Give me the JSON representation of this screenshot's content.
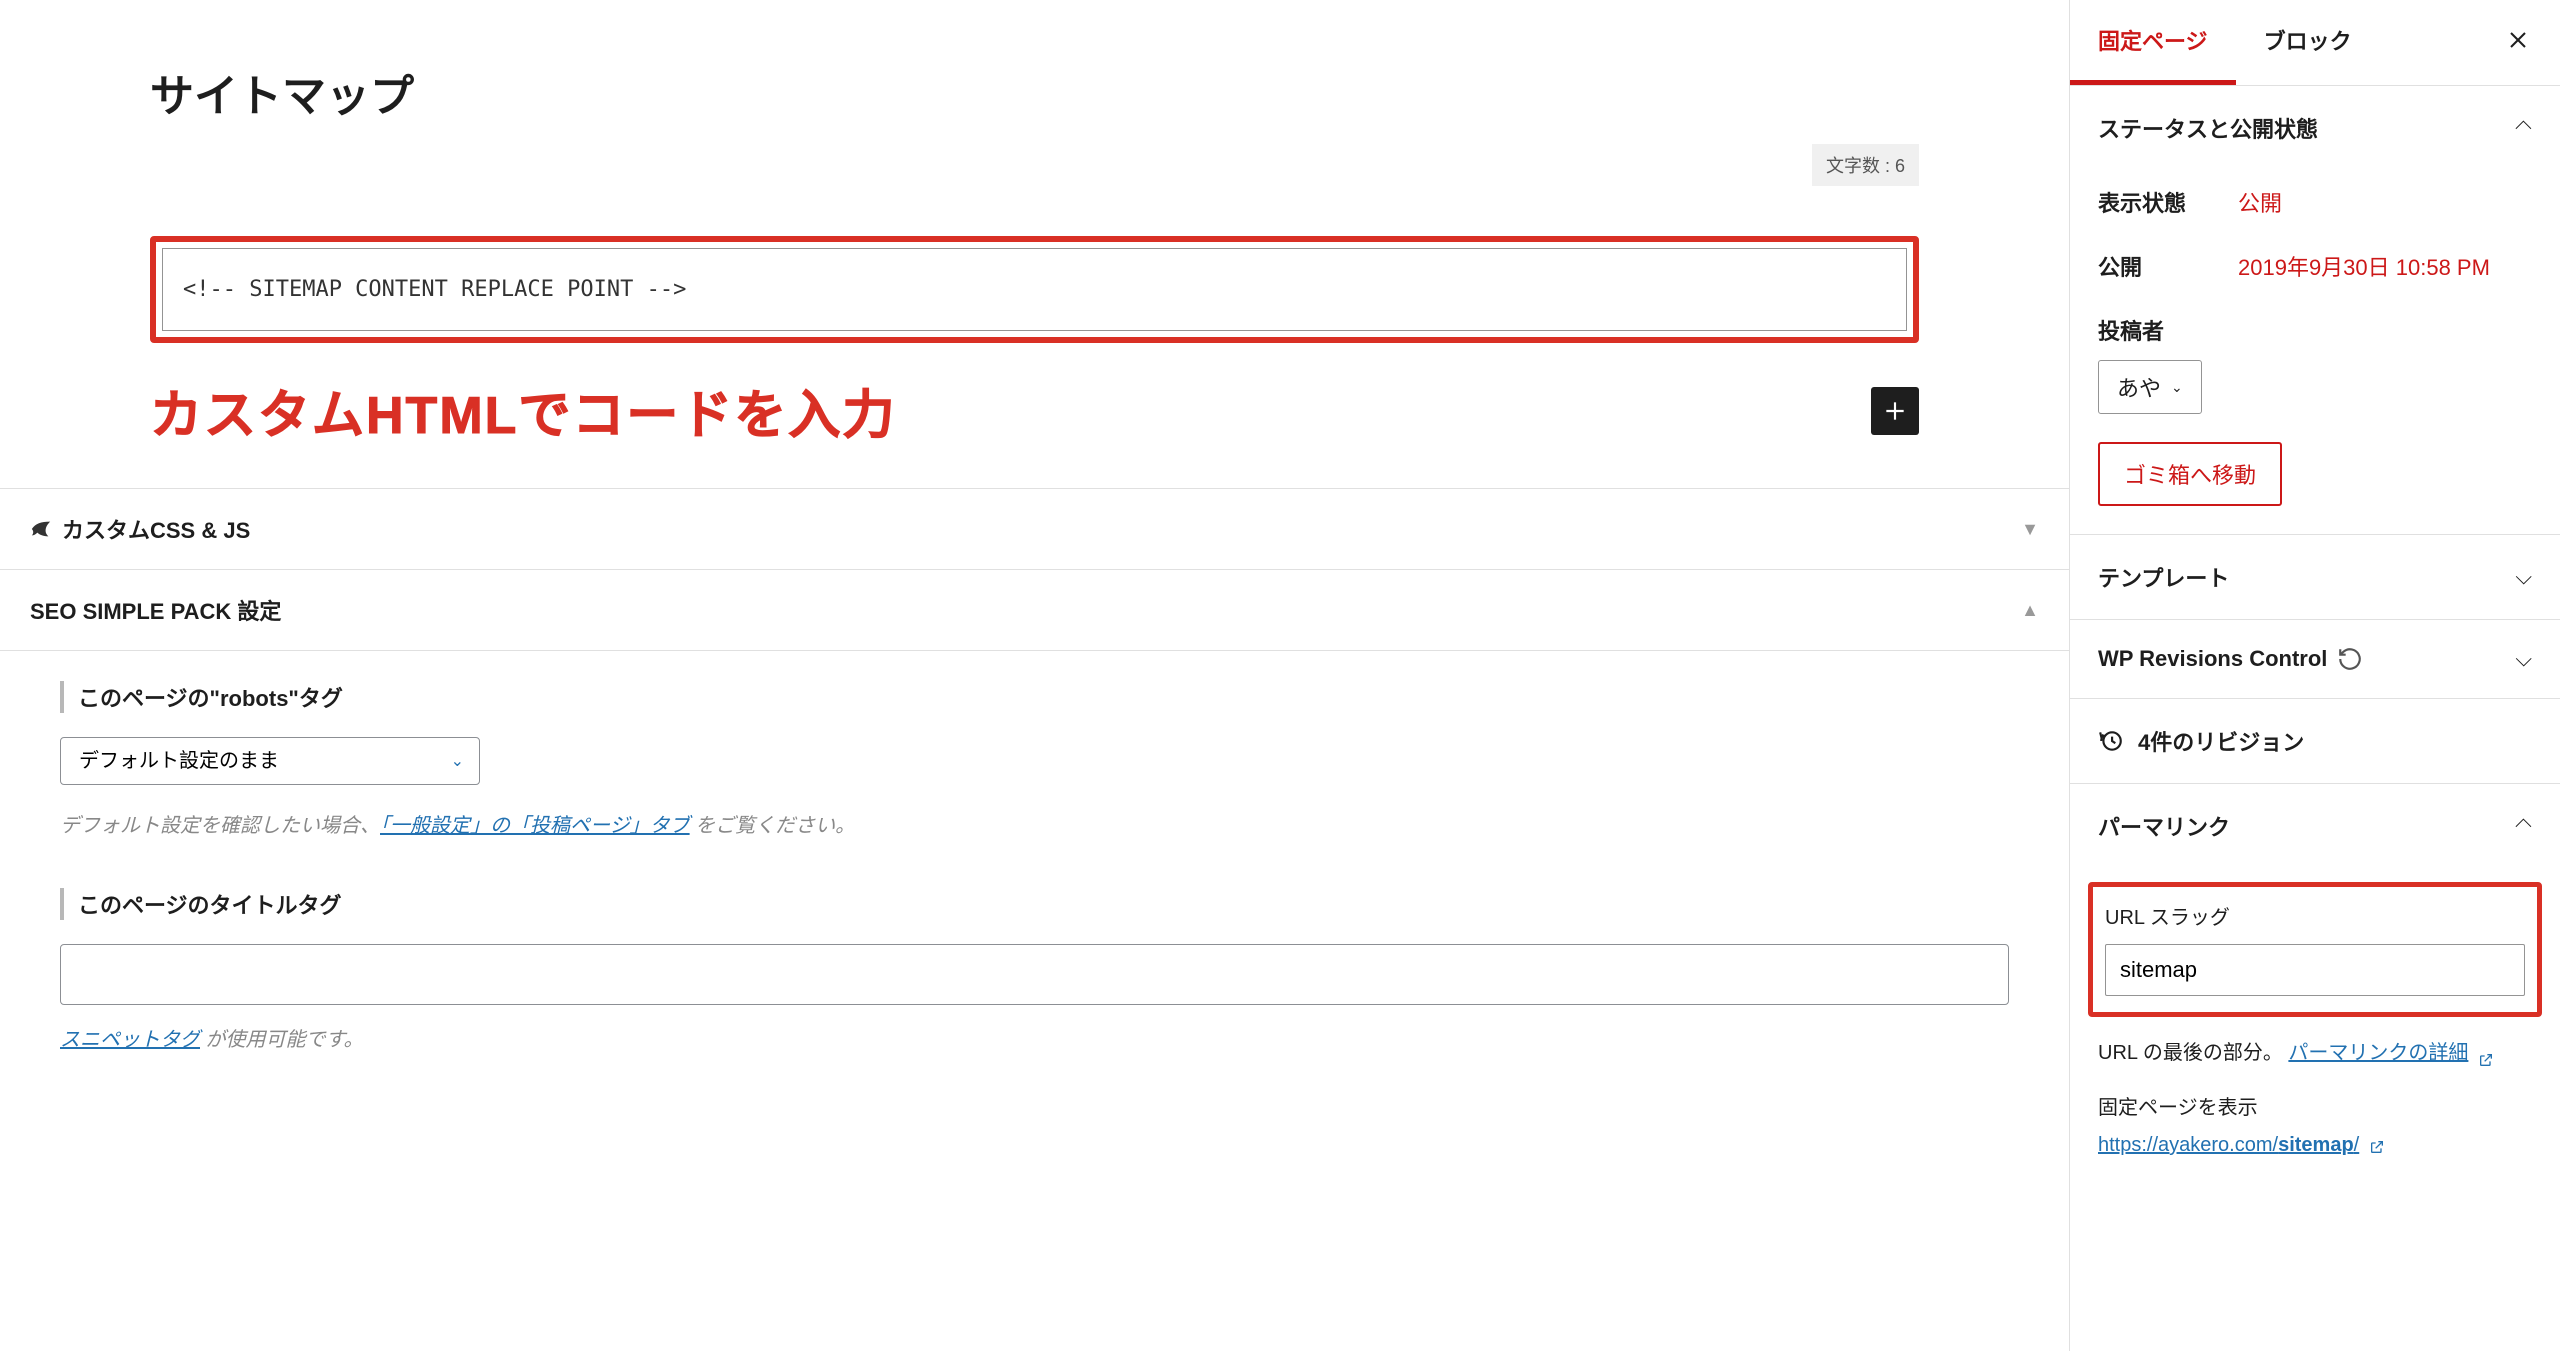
{
  "editor": {
    "page_title": "サイトマップ",
    "char_count_label": "文字数 : 6",
    "html_block_content": "<!-- SITEMAP CONTENT REPLACE POINT -->",
    "annotation": "カスタムHTMLでコードを入力"
  },
  "meta_panels": {
    "custom_css_js": "カスタムCSS & JS",
    "seo_pack": "SEO SIMPLE PACK 設定",
    "robots": {
      "label": "このページの\"robots\"タグ",
      "select_value": "デフォルト設定のまま",
      "help_prefix": "デフォルト設定を確認したい場合、",
      "help_link": "「一般設定」の「投稿ページ」タブ",
      "help_suffix": " をご覧ください。"
    },
    "title_tag": {
      "label": "このページのタイトルタグ",
      "input_value": "",
      "snippet_link": "スニペットタグ",
      "snippet_suffix": " が使用可能です。"
    }
  },
  "sidebar": {
    "tabs": {
      "page": "固定ページ",
      "block": "ブロック"
    },
    "status_panel": {
      "title": "ステータスと公開状態",
      "visibility_label": "表示状態",
      "visibility_value": "公開",
      "publish_label": "公開",
      "publish_value": "2019年9月30日 10:58 PM",
      "author_label": "投稿者",
      "author_value": "あや",
      "trash": "ゴミ箱へ移動"
    },
    "template_panel": "テンプレート",
    "wp_revisions_panel": "WP Revisions Control",
    "revisions_count": "4件のリビジョン",
    "permalink_panel": {
      "title": "パーマリンク",
      "slug_label": "URL スラッグ",
      "slug_value": "sitemap",
      "help_prefix": "URL の最後の部分。 ",
      "help_link": "パーマリンクの詳細",
      "display_label": "固定ページを表示",
      "url_prefix": "https://ayakero.com/",
      "url_slug": "sitemap",
      "url_suffix": "/"
    }
  }
}
